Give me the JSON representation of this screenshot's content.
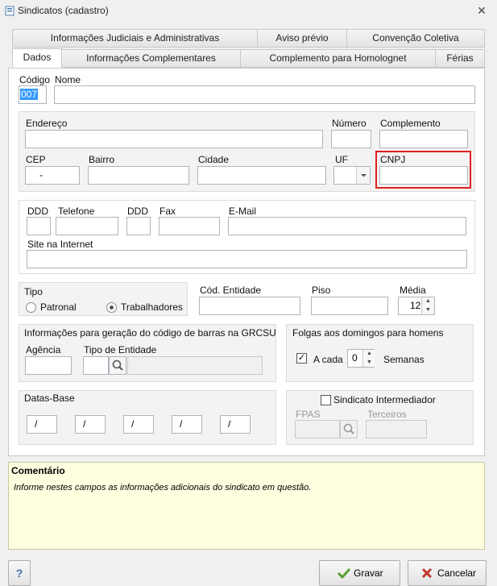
{
  "window": {
    "title": "Sindicatos (cadastro)"
  },
  "tabs_top": [
    {
      "label": "Informações Judiciais e Administrativas"
    },
    {
      "label": "Aviso prévio"
    },
    {
      "label": "Convenção Coletiva"
    }
  ],
  "tabs_bottom": [
    {
      "label": "Dados"
    },
    {
      "label": "Informações Complementares"
    },
    {
      "label": "Complemento para Homolognet"
    },
    {
      "label": "Férias"
    }
  ],
  "form": {
    "codigo_label": "Código",
    "codigo_value": "007",
    "nome_label": "Nome",
    "nome_value": "",
    "endereco_label": "Endereço",
    "numero_label": "Número",
    "complemento_label": "Complemento",
    "cep_label": "CEP",
    "cep_value": "-",
    "bairro_label": "Bairro",
    "cidade_label": "Cidade",
    "uf_label": "UF",
    "cnpj_label": "CNPJ",
    "ddd_label": "DDD",
    "telefone_label": "Telefone",
    "ddd2_label": "DDD",
    "fax_label": "Fax",
    "email_label": "E-Mail",
    "site_label": "Site na Internet",
    "tipo_label": "Tipo",
    "patronal_label": "Patronal",
    "trabalhadores_label": "Trabalhadores",
    "cod_entidade_label": "Cód. Entidade",
    "piso_label": "Piso",
    "media_label": "Média",
    "media_value": "12",
    "grcsu_title": "Informações para geração do código de barras na GRCSU",
    "agencia_label": "Agência",
    "tipo_entidade_label": "Tipo de Entidade",
    "folgas_title": "Folgas aos domingos para homens",
    "acada_label": "A cada",
    "acada_value": "0",
    "semanas_label": "Semanas",
    "datas_base_label": "Datas-Base",
    "date_slash": "/",
    "intermediador_label": "Sindicato Intermediador",
    "fpas_label": "FPAS",
    "terceiros_label": "Terceiros"
  },
  "comment": {
    "title": "Comentário",
    "text": "Informe nestes campos as informações adicionais do sindicato em questão."
  },
  "footer": {
    "help_label": "?",
    "save_label": "Gravar",
    "cancel_label": "Cancelar"
  }
}
